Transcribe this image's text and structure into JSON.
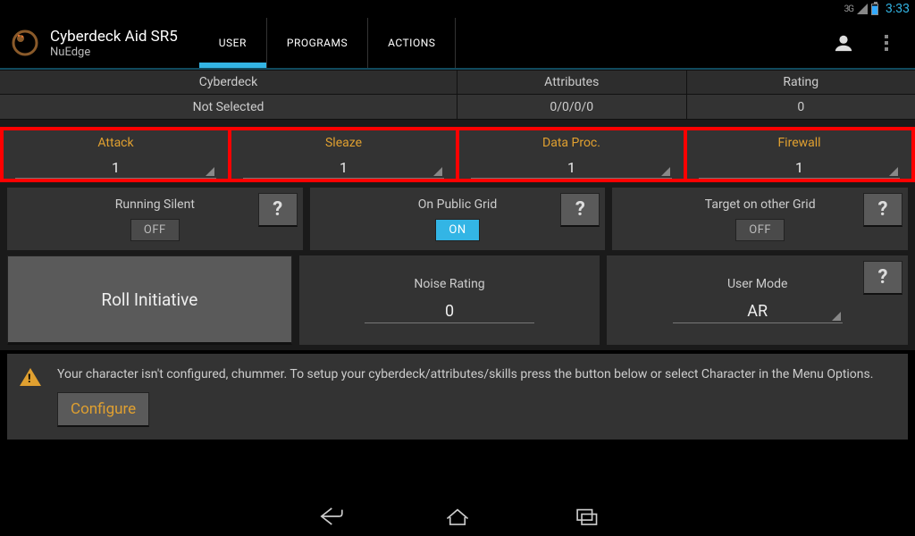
{
  "status": {
    "net": "3G",
    "clock": "3:33"
  },
  "header": {
    "title": "Cyberdeck Aid SR5",
    "subtitle": "NuEdge",
    "tabs": [
      "USER",
      "PROGRAMS",
      "ACTIONS"
    ],
    "active_tab": 0
  },
  "info": {
    "labels": {
      "deck": "Cyberdeck",
      "attrs": "Attributes",
      "rating": "Rating"
    },
    "values": {
      "deck": "Not Selected",
      "attrs": "0/0/0/0",
      "rating": "0"
    }
  },
  "asdf": {
    "attack": {
      "label": "Attack",
      "value": "1"
    },
    "sleaze": {
      "label": "Sleaze",
      "value": "1"
    },
    "dataproc": {
      "label": "Data Proc.",
      "value": "1"
    },
    "firewall": {
      "label": "Firewall",
      "value": "1"
    }
  },
  "cards": {
    "silent": {
      "label": "Running Silent",
      "state": "OFF"
    },
    "public": {
      "label": "On Public Grid",
      "state": "ON"
    },
    "othergrid": {
      "label": "Target on other Grid",
      "state": "OFF"
    },
    "roll": {
      "label": "Roll Initiative"
    },
    "noise": {
      "label": "Noise Rating",
      "value": "0"
    },
    "usermode": {
      "label": "User Mode",
      "value": "AR"
    },
    "help_glyph": "?"
  },
  "warning": {
    "text": "Your character isn't configured, chummer. To setup your cyberdeck/attributes/skills press the button below or select Character in the Menu Options.",
    "button": "Configure"
  }
}
